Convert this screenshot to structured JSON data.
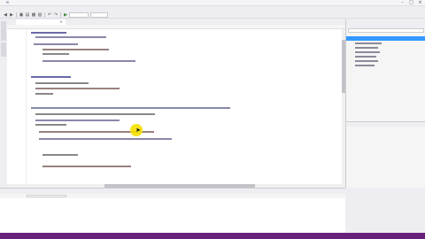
{
  "window": {
    "title": ""
  },
  "menu": [],
  "toolbar": {
    "config": "",
    "platform": ""
  },
  "editor": {
    "tab_label": "",
    "nav": {
      "project": "",
      "type": "",
      "member": ""
    }
  },
  "solution_explorer": {
    "title": "",
    "search_placeholder": "",
    "items": []
  },
  "properties": {
    "title": ""
  },
  "output": {
    "title": "",
    "show_output_from": ""
  },
  "status": {
    "left": "",
    "ln": "",
    "col": "",
    "ch": "",
    "mode": ""
  },
  "colors": {
    "accent": "#68217a",
    "keyword": "#0000ff",
    "string": "#a31515",
    "type": "#2b91af",
    "selection": "#3399ff",
    "cursor_highlight": "#f6e000"
  },
  "icons": {
    "logo": "visual-studio-logo-icon",
    "minimize": "minimize-icon",
    "maximize": "maximize-icon",
    "close": "close-icon",
    "pointer": "mouse-pointer-icon"
  }
}
